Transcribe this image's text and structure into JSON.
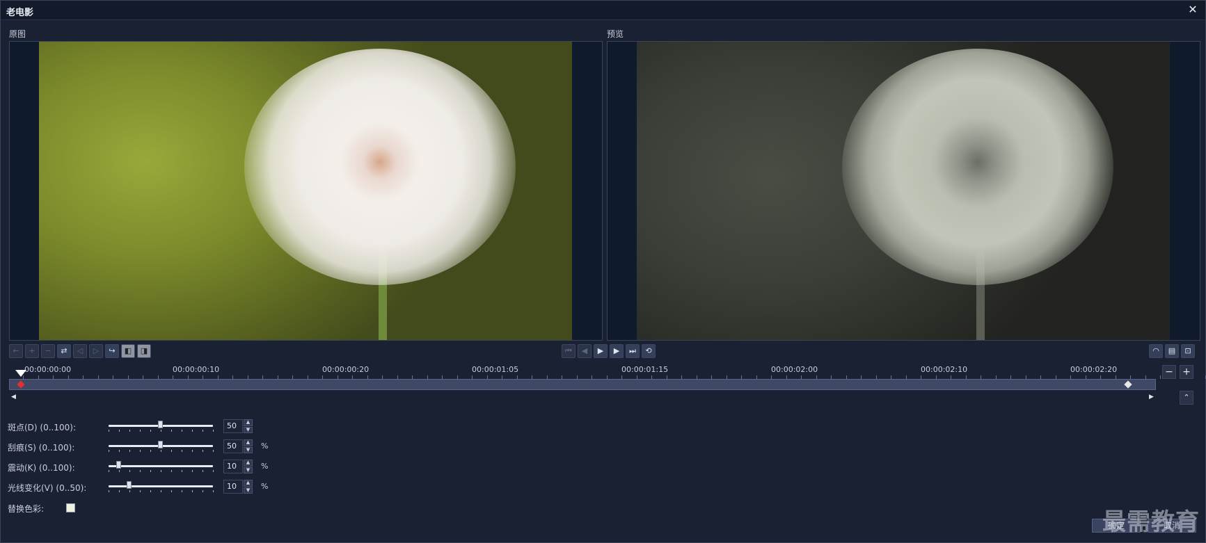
{
  "window": {
    "title": "老电影",
    "close_symbol": "✕"
  },
  "panes": {
    "original_label": "原图",
    "preview_label": "预览"
  },
  "toolbar_left": [
    {
      "icon": "arrow-left-icon",
      "glyph": "←"
    },
    {
      "icon": "plus-icon",
      "glyph": "+"
    },
    {
      "icon": "minus-icon",
      "glyph": "−"
    },
    {
      "icon": "reverse-keyframe-icon",
      "glyph": "⇄"
    },
    {
      "icon": "prev-keyframe-icon",
      "glyph": "◁"
    },
    {
      "icon": "next-keyframe-icon",
      "glyph": "▷"
    },
    {
      "icon": "jump-icon",
      "glyph": "↪"
    },
    {
      "icon": "fade-in-icon",
      "glyph": "◧"
    },
    {
      "icon": "fade-out-icon",
      "glyph": "◨"
    }
  ],
  "playback": [
    {
      "icon": "home-icon",
      "glyph": "⏮"
    },
    {
      "icon": "prev-frame-icon",
      "glyph": "◀"
    },
    {
      "icon": "play-icon",
      "glyph": "▶"
    },
    {
      "icon": "next-frame-icon",
      "glyph": "▶"
    },
    {
      "icon": "end-icon",
      "glyph": "⏭"
    },
    {
      "icon": "repeat-icon",
      "glyph": "⟲"
    }
  ],
  "toolbar_right": [
    {
      "icon": "meter-icon",
      "glyph": "◠"
    },
    {
      "icon": "preview-monitor-icon",
      "glyph": "▤"
    },
    {
      "icon": "zoom-monitor-icon",
      "glyph": "⊡"
    }
  ],
  "timeline": {
    "timecodes": [
      "00:00:00:00",
      "00:00:00:10",
      "00:00:00:20",
      "00:00:01:05",
      "00:00:01:15",
      "00:00:02:00",
      "00:00:02:10",
      "00:00:02:20"
    ],
    "zoom_out": "−",
    "zoom_in": "+",
    "scroll_left": "◀",
    "scroll_right": "▶",
    "collapse": "⌃"
  },
  "params": [
    {
      "label": "斑点(D) (0..100):",
      "value": "50",
      "fraction": 0.5,
      "unit": ""
    },
    {
      "label": "刮痕(S) (0..100):",
      "value": "50",
      "fraction": 0.5,
      "unit": "%"
    },
    {
      "label": "震动(K) (0..100):",
      "value": "10",
      "fraction": 0.1,
      "unit": "%"
    },
    {
      "label": "光线变化(V) (0..50):",
      "value": "10",
      "fraction": 0.2,
      "unit": "%"
    }
  ],
  "replace_color": {
    "label": "替换色彩:",
    "color": "#eef3df"
  },
  "footer": {
    "ok": "确定",
    "cancel": "取消"
  },
  "watermark": "最需教育"
}
